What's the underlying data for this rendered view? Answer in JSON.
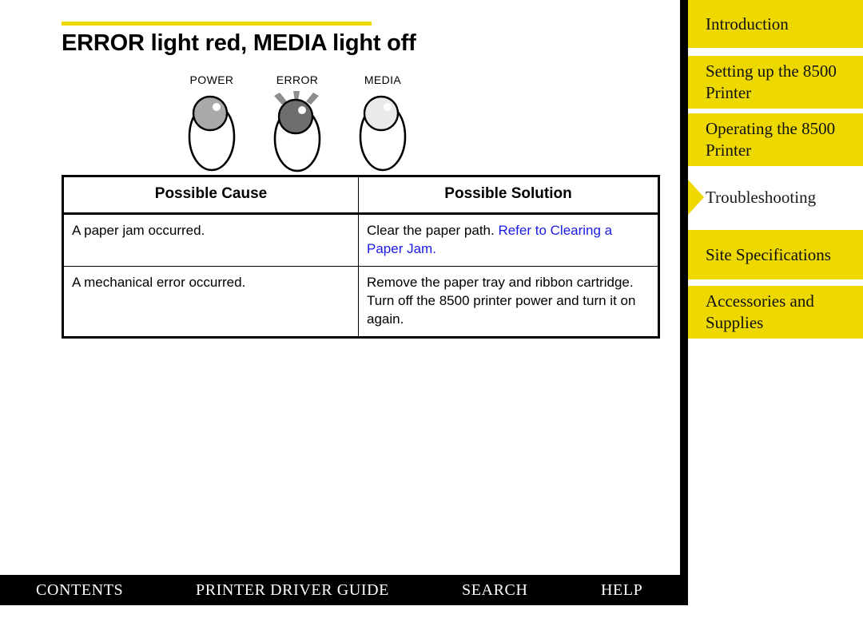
{
  "page": {
    "title": "ERROR light red, MEDIA light off",
    "accent_yellow": "#edd800",
    "link_blue": "#1a1ae6"
  },
  "led_panel": {
    "indicators": [
      {
        "label": "POWER",
        "state": "on-dim",
        "fill": "#a9a9a9",
        "flashing": false
      },
      {
        "label": "ERROR",
        "state": "lit-red",
        "fill": "#6e6e6e",
        "flashing": true
      },
      {
        "label": "MEDIA",
        "state": "off",
        "fill": "#eaeaea",
        "flashing": false
      }
    ]
  },
  "table": {
    "headers": [
      "Possible Cause",
      "Possible Solution"
    ],
    "rows": [
      {
        "cause": "A paper jam occurred.",
        "solution_lead": "Clear the paper path. ",
        "solution_link": "Refer to Clearing a Paper Jam."
      },
      {
        "cause": "A mechanical error occurred.",
        "solution_lead": "Remove the paper tray and ribbon cartridge. Turn off the 8500 printer power and turn it on again.",
        "solution_link": ""
      }
    ]
  },
  "sidebar": {
    "items": [
      {
        "label": "Introduction",
        "active": false
      },
      {
        "label": "Setting up the 8500 Printer",
        "active": false
      },
      {
        "label": "Operating the 8500 Printer",
        "active": false
      },
      {
        "label": "Troubleshooting",
        "active": true
      },
      {
        "label": "Site Specifications",
        "active": false
      },
      {
        "label": "Accessories and Supplies",
        "active": false
      }
    ]
  },
  "bottom_bar": {
    "links": [
      "CONTENTS",
      "PRINTER DRIVER GUIDE",
      "SEARCH",
      "HELP"
    ]
  }
}
